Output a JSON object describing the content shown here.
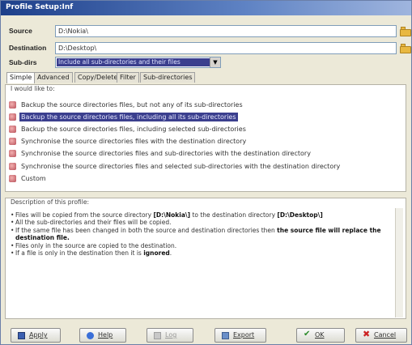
{
  "window": {
    "title": "Profile Setup:Inf"
  },
  "form": {
    "source_label": "Source",
    "source_value": "D:\\Nokia\\",
    "destination_label": "Destination",
    "destination_value": "D:\\Desktop\\",
    "subdirs_label": "Sub-dirs",
    "subdirs_value": "Include all sub-directories and their files"
  },
  "tabs": [
    "Simple",
    "Advanced",
    "Copy/Delete",
    "Filter",
    "Sub-directories"
  ],
  "options_group": {
    "title": "I would like to:",
    "items": [
      "Backup the source directories files, but not any of its sub-directories",
      "Backup the source directories files, including all its sub-directories",
      "Backup the source directories files, including selected sub-directories",
      "Synchronise the source directories files with the destination directory",
      "Synchronise the source directories files and sub-directories with the destination directory",
      "Synchronise the source directories files and selected sub-directories with the destination directory",
      "Custom"
    ],
    "selected_index": 1
  },
  "description": {
    "title": "Description of this profile:",
    "lines": [
      {
        "pre": "Files will be copied from the source directory ",
        "b1": "[D:\\Nokia\\]",
        "mid": " to the destination directory ",
        "b2": "[D:\\Desktop\\]"
      },
      {
        "pre": "All the sub-directories and their files will be copied.",
        "b1": "",
        "mid": "",
        "b2": ""
      },
      {
        "pre": "If the same file has been changed in both the source and destination directories then ",
        "b1": "the source file will replace the",
        "mid": "",
        "b2": ""
      },
      {
        "pre": "",
        "b1": "destination file.",
        "mid": "",
        "b2": "",
        "continuation": true
      },
      {
        "pre": "Files only in the source are copied to the destination.",
        "b1": "",
        "mid": "",
        "b2": ""
      },
      {
        "pre": "If a file is only in the destination then it is ",
        "b1": "ignored",
        "mid": ".",
        "b2": ""
      }
    ]
  },
  "buttons": {
    "apply": "Apply",
    "help": "Help",
    "log": "Log",
    "export": "Export",
    "ok": "OK",
    "cancel": "Cancel"
  }
}
